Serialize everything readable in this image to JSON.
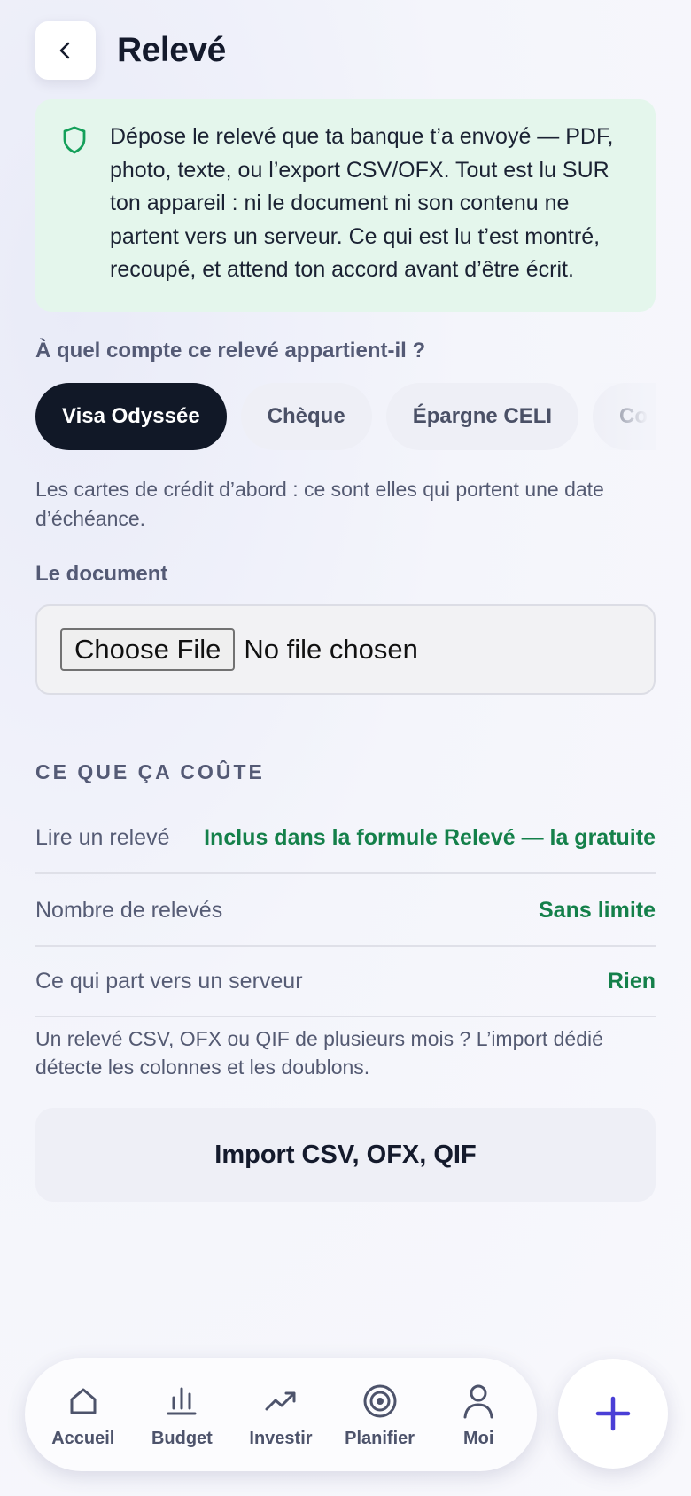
{
  "header": {
    "title": "Relevé",
    "back_icon": "chevron-left-icon"
  },
  "notice": {
    "icon": "shield-icon",
    "text": "Dépose le relevé que ta banque t’a envoyé — PDF, photo, texte, ou l’export CSV/OFX. Tout est lu SUR ton appareil : ni le document ni son contenu ne partent vers un serveur. Ce qui est lu t’est montré, recoupé, et attend ton accord avant d’être écrit."
  },
  "account": {
    "question": "À quel compte ce relevé appartient-il ?",
    "chips": [
      {
        "label": "Visa Odyssée",
        "selected": true
      },
      {
        "label": "Chèque",
        "selected": false
      },
      {
        "label": "Épargne CELI",
        "selected": false
      },
      {
        "label": "Compte US",
        "selected": false
      }
    ],
    "hint": "Les cartes de crédit d’abord : ce sont elles qui portent une date d’échéance."
  },
  "document": {
    "label": "Le document",
    "button_label": "Choose File",
    "status": "No file chosen"
  },
  "cost": {
    "heading": "CE QUE ÇA COÛTE",
    "rows": [
      {
        "key": "Lire un relevé",
        "value": "Inclus dans la formule Relevé — la gratuite"
      },
      {
        "key": "Nombre de relevés",
        "value": "Sans limite"
      },
      {
        "key": "Ce qui part vers un serveur",
        "value": "Rien"
      }
    ],
    "note": "Un relevé CSV, OFX ou QIF de plusieurs mois ? L’import dédié détecte les colonnes et les doublons.",
    "import_button": "Import CSV, OFX, QIF"
  },
  "nav": {
    "items": [
      {
        "label": "Accueil",
        "icon": "home-icon"
      },
      {
        "label": "Budget",
        "icon": "bar-chart-icon"
      },
      {
        "label": "Investir",
        "icon": "trending-up-icon"
      },
      {
        "label": "Planifier",
        "icon": "target-icon"
      },
      {
        "label": "Moi",
        "icon": "user-icon"
      }
    ],
    "fab_icon": "plus-icon"
  },
  "colors": {
    "accent": "#4a3fd6",
    "success": "#14804a",
    "notice_bg": "#e4f6ec",
    "dark": "#111827"
  }
}
